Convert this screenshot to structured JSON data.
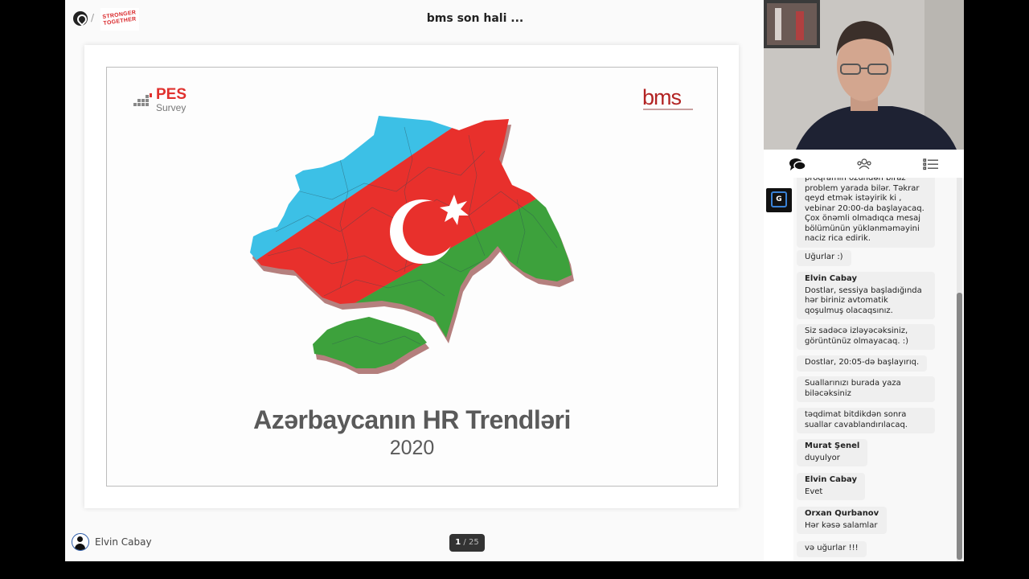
{
  "header": {
    "title": "bms son hali ...",
    "breadcrumb_sep": "/",
    "brand_badge": "STRONGER TOGETHER"
  },
  "slide": {
    "pes_logo": {
      "line1": "PES",
      "line2": "Survey"
    },
    "bms_logo": "bms",
    "title": "Azərbaycanın HR Trendləri",
    "year": "2020"
  },
  "presenter": {
    "name": "Elvin Cabay"
  },
  "pager": {
    "current": "1",
    "separator": "/",
    "total": "25"
  },
  "tabs": [
    {
      "name": "chat",
      "icon": "chat-bubbles-icon"
    },
    {
      "name": "participants",
      "icon": "people-icon"
    },
    {
      "name": "agenda",
      "icon": "list-icon"
    }
  ],
  "side_button": {
    "label": "G"
  },
  "chat": [
    {
      "author": "",
      "text": "proqramın özündən biraz problem yarada bilər. Təkrar qeyd etmək istəyirik ki , vebinar 20:00-da başlayacaq. Çox önəmli olmadıqca mesaj bölümünün yüklənməməyini naciz rica edirik."
    },
    {
      "author": "",
      "text": "Uğurlar :)"
    },
    {
      "author": "Elvin Cabay",
      "text": "Dostlar, sessiya başladığında hər biriniz avtomatik qoşulmuş olacaqsınız."
    },
    {
      "author": "",
      "text": "Siz sadəcə izləyəcəksiniz, görüntünüz olmayacaq. :)"
    },
    {
      "author": "",
      "text": "Dostlar, 20:05-də başlayırıq."
    },
    {
      "author": "",
      "text": "Suallarınızı burada yaza biləcəksiniz"
    },
    {
      "author": "",
      "text": "təqdimat bitdikdən sonra suallar cavablandırılacaq."
    },
    {
      "author": "Murat Şenel",
      "text": "duyulyor"
    },
    {
      "author": "Elvin Cabay",
      "text": "Evet"
    },
    {
      "author": "Orxan Qurbanov",
      "text": "Hər kəsə salamlar"
    },
    {
      "author": "",
      "text": "və uğurlar !!!"
    }
  ],
  "colors": {
    "flag_blue": "#3cc0e6",
    "flag_red": "#e8302c",
    "flag_green": "#3da13c",
    "bms_red": "#b32323",
    "pes_red": "#e0312e"
  }
}
